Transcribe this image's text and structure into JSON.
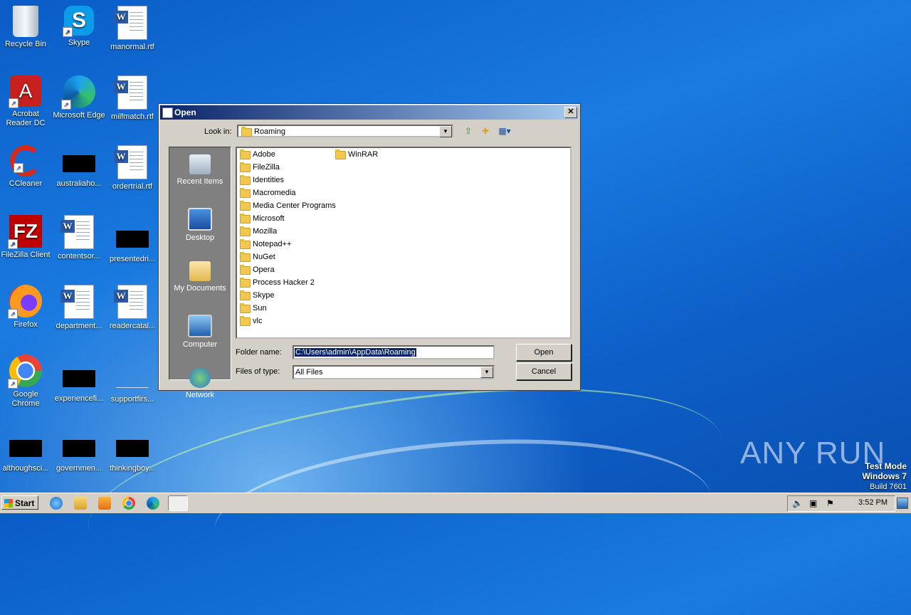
{
  "desktop": {
    "icons": [
      {
        "label": "Recycle Bin"
      },
      {
        "label": "Skype"
      },
      {
        "label": "manormal.rtf"
      },
      {
        "label": "Acrobat Reader DC"
      },
      {
        "label": "Microsoft Edge"
      },
      {
        "label": "milfmatch.rtf"
      },
      {
        "label": "CCleaner"
      },
      {
        "label": "australiaho..."
      },
      {
        "label": "ordertrial.rtf"
      },
      {
        "label": "FileZilla Client"
      },
      {
        "label": "contentsor..."
      },
      {
        "label": "presentedri..."
      },
      {
        "label": "Firefox"
      },
      {
        "label": "department..."
      },
      {
        "label": "readercatal..."
      },
      {
        "label": "Google Chrome"
      },
      {
        "label": "experiencefi..."
      },
      {
        "label": "supportfirs..."
      },
      {
        "label": "althoughsci..."
      },
      {
        "label": "governmen..."
      },
      {
        "label": "thinkingboy..."
      }
    ]
  },
  "dialog": {
    "title": "Open",
    "look_in_label": "Look in:",
    "look_in_value": "Roaming",
    "places": [
      {
        "label": "Recent Items",
        "icon": "recent-items-icon"
      },
      {
        "label": "Desktop",
        "icon": "desktop-icon"
      },
      {
        "label": "My Documents",
        "icon": "documents-icon"
      },
      {
        "label": "Computer",
        "icon": "computer-icon"
      },
      {
        "label": "Network",
        "icon": "network-icon"
      }
    ],
    "folders_col1": [
      "Adobe",
      "FileZilla",
      "Identities",
      "Macromedia",
      "Media Center Programs",
      "Microsoft",
      "Mozilla",
      "Notepad++",
      "NuGet",
      "Opera",
      "Process Hacker 2",
      "Skype",
      "Sun",
      "vlc"
    ],
    "folders_col2": [
      "WinRAR"
    ],
    "folder_name_label": "Folder name:",
    "folder_name_value": "C:\\Users\\admin\\AppData\\Roaming",
    "files_of_type_label": "Files of type:",
    "files_of_type_value": "All Files",
    "open_label": "Open",
    "cancel_label": "Cancel"
  },
  "taskbar": {
    "start_label": "Start",
    "clock": "3:52 PM"
  },
  "watermark": {
    "line1": "Test Mode",
    "line2": "Windows 7",
    "line3": "Build 7601",
    "anyrun": "ANY RUN"
  },
  "colors": {
    "title_gradient_start": "#0a246a",
    "title_gradient_end": "#a6caf0",
    "dialog_face": "#d4d0c8",
    "desktop_blue": "#1a7be0"
  }
}
